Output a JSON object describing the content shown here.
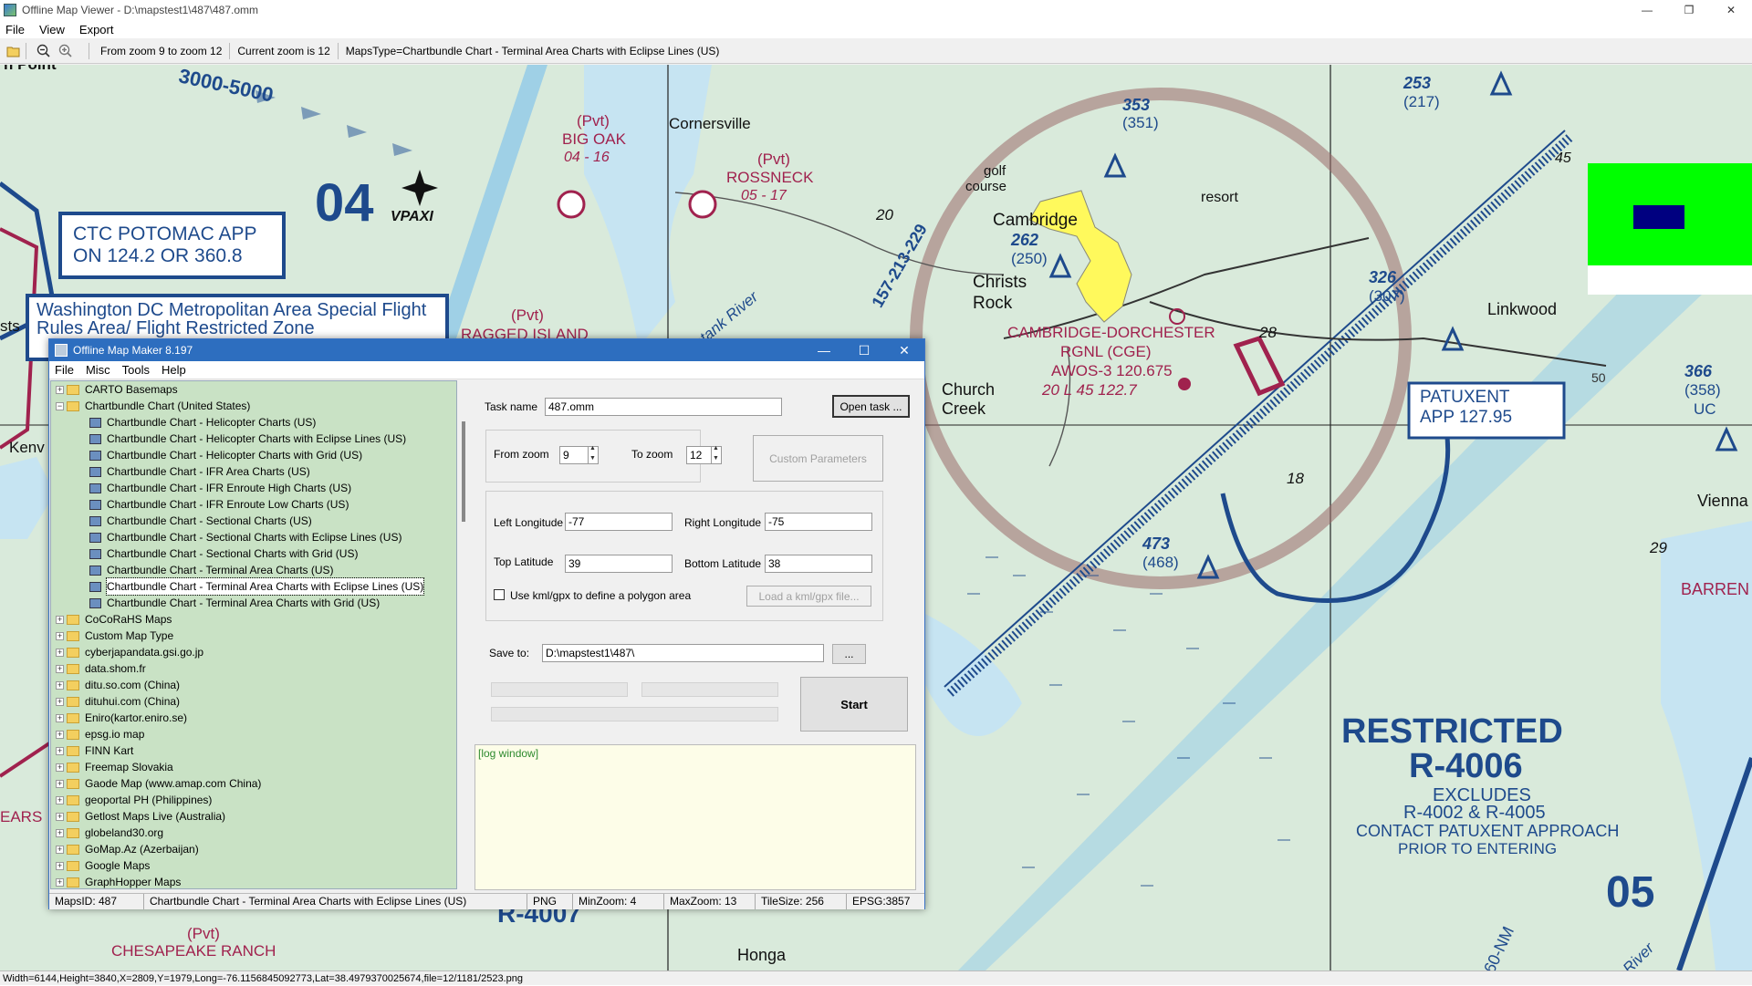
{
  "main_window": {
    "title": "Offline Map Viewer - D:\\mapstest1\\487\\487.omm",
    "controls": {
      "minimize": "—",
      "maximize": "❐",
      "close": "✕"
    },
    "menu": [
      "File",
      "View",
      "Export"
    ],
    "toolbar": {
      "zoom_range": "From zoom 9 to zoom 12",
      "current_zoom": "Current zoom is 12",
      "maps_type": "MapsType=Chartbundle Chart - Terminal Area Charts with Eclipse Lines (US)"
    },
    "status": "Width=6144,Height=3840,X=2809,Y=1979,Long=-76.1156845092773,Lat=38.4979370025674,file=12/1181/2523.png"
  },
  "map_labels": {
    "point": "n Point",
    "kenv": "Kenv",
    "sts": "sts",
    "ears": "EARS",
    "alt_band": "3000-5000",
    "runway": "04",
    "vpaxi": "VPAXI",
    "ctc1": "CTC POTOMAC APP",
    "ctc2": "ON 124.2 OR 360.8",
    "dc1": "Washington DC Metropolitan Area Special Flight",
    "dc2": "Rules Area/ Flight Restricted Zone",
    "pvt1": "(Pvt)",
    "bigoak": "BIG OAK",
    "bigoak_n": "04 - 16",
    "cornersville": "Cornersville",
    "pvt2": "(Pvt)",
    "rossneck": "ROSSNECK",
    "rossneck_n": "05 - 17",
    "pvt3": "(Pvt)",
    "ragged": "RAGGED ISLAND",
    "golf": "golf",
    "course": "course",
    "resort": "resort",
    "cambridge": "Cambridge",
    "alt262": "262",
    "alt250": "(250)",
    "alt353": "353",
    "alt351": "(351)",
    "christs": "Christs",
    "rock": "Rock",
    "choptank": "Choptank River",
    "radial": "157-213-229",
    "cambridge_dorchester": "CAMBRIDGE-DORCHESTER",
    "rgnl": "RGNL (CGE)",
    "awos": "AWOS-3 120.675",
    "freq": "20  L 45 122.7",
    "church": "Church",
    "creek": "Creek",
    "n18": "18",
    "n20": "20",
    "n28": "28",
    "alt326": "326",
    "alt307": "(307)",
    "linkwood": "Linkwood",
    "alt253": "253",
    "alt217": "(217)",
    "n45": "45",
    "patuxent1": "PATUXENT",
    "patuxent2": "APP 127.95",
    "alt366": "366",
    "alt358": "(358)",
    "uc": "UC",
    "vienna": "Vienna",
    "n29": "29",
    "barren": "BARREN",
    "alt473": "473",
    "alt468": "(468)",
    "restricted": "RESTRICTED",
    "r4006": "R-4006",
    "excludes": "EXCLUDES",
    "r4002": "R-4002 & R-4005",
    "contact1": "CONTACT PATUXENT APPROACH",
    "contact2": "PRIOR TO ENTERING",
    "r4007": "R-4007",
    "pvt4": "(Pvt)",
    "chesapeake": "CHESAPEAKE RANCH",
    "honga": "Honga",
    "n05": "05",
    "nm": "60-NM",
    "river": "River",
    "route50": "50"
  },
  "dialog": {
    "title": "Offline Map Maker 8.197",
    "controls": {
      "minimize": "—",
      "maximize": "☐",
      "close": "✕"
    },
    "menu": [
      "File",
      "Misc",
      "Tools",
      "Help"
    ],
    "tree": [
      {
        "label": "CARTO Basemaps",
        "type": "folder",
        "expanded": false
      },
      {
        "label": "Chartbundle Chart (United States)",
        "type": "folder",
        "expanded": true
      },
      {
        "label": "Chartbundle Chart - Helicopter Charts (US)",
        "type": "leaf"
      },
      {
        "label": "Chartbundle Chart - Helicopter Charts with Eclipse Lines (US)",
        "type": "leaf"
      },
      {
        "label": "Chartbundle Chart - Helicopter Charts with Grid (US)",
        "type": "leaf"
      },
      {
        "label": "Chartbundle Chart - IFR Area Charts (US)",
        "type": "leaf"
      },
      {
        "label": "Chartbundle Chart - IFR Enroute High Charts (US)",
        "type": "leaf"
      },
      {
        "label": "Chartbundle Chart - IFR Enroute Low Charts (US)",
        "type": "leaf"
      },
      {
        "label": "Chartbundle Chart - Sectional Charts (US)",
        "type": "leaf"
      },
      {
        "label": "Chartbundle Chart - Sectional Charts with Eclipse Lines (US)",
        "type": "leaf"
      },
      {
        "label": "Chartbundle Chart - Sectional Charts with Grid (US)",
        "type": "leaf"
      },
      {
        "label": "Chartbundle Chart - Terminal Area Charts (US)",
        "type": "leaf"
      },
      {
        "label": "Chartbundle Chart - Terminal Area Charts with Eclipse Lines (US)",
        "type": "leaf",
        "selected": true
      },
      {
        "label": "Chartbundle Chart - Terminal Area Charts with Grid (US)",
        "type": "leaf"
      },
      {
        "label": "CoCoRaHS Maps",
        "type": "folder",
        "expanded": false
      },
      {
        "label": "Custom Map Type",
        "type": "folder",
        "expanded": false
      },
      {
        "label": "cyberjapandata.gsi.go.jp",
        "type": "folder",
        "expanded": false
      },
      {
        "label": "data.shom.fr",
        "type": "folder",
        "expanded": false
      },
      {
        "label": "ditu.so.com (China)",
        "type": "folder",
        "expanded": false
      },
      {
        "label": "dituhui.com (China)",
        "type": "folder",
        "expanded": false
      },
      {
        "label": "Eniro(kartor.eniro.se)",
        "type": "folder",
        "expanded": false
      },
      {
        "label": "epsg.io map",
        "type": "folder",
        "expanded": false
      },
      {
        "label": "FINN Kart",
        "type": "folder",
        "expanded": false
      },
      {
        "label": "Freemap Slovakia",
        "type": "folder",
        "expanded": false
      },
      {
        "label": "Gaode Map (www.amap.com China)",
        "type": "folder",
        "expanded": false
      },
      {
        "label": "geoportal PH (Philippines)",
        "type": "folder",
        "expanded": false
      },
      {
        "label": "Getlost Maps Live (Australia)",
        "type": "folder",
        "expanded": false
      },
      {
        "label": "globeland30.org",
        "type": "folder",
        "expanded": false
      },
      {
        "label": "GoMap.Az (Azerbaijan)",
        "type": "folder",
        "expanded": false
      },
      {
        "label": "Google Maps",
        "type": "folder",
        "expanded": false
      },
      {
        "label": "GraphHopper Maps",
        "type": "folder",
        "expanded": false
      }
    ],
    "task_name_label": "Task name",
    "task_name_value": "487.omm",
    "open_task": "Open task ...",
    "from_zoom_label": "From zoom",
    "from_zoom_value": "9",
    "to_zoom_label": "To zoom",
    "to_zoom_value": "12",
    "custom_params": "Custom Parameters",
    "left_lon_label": "Left Longitude",
    "left_lon_value": "-77",
    "right_lon_label": "Right Longitude",
    "right_lon_value": "-75",
    "top_lat_label": "Top Latitude",
    "top_lat_value": "39",
    "bottom_lat_label": "Bottom Latitude",
    "bottom_lat_value": "38",
    "kml_label": "Use kml/gpx to define a polygon area",
    "load_kml": "Load a kml/gpx file...",
    "save_to_label": "Save to:",
    "save_to_value": "D:\\mapstest1\\487\\",
    "browse": "...",
    "start": "Start",
    "log": "[log window]",
    "status": {
      "maps_id": "MapsID: 487",
      "maps_name": "Chartbundle Chart - Terminal Area Charts with Eclipse Lines (US)",
      "format": "PNG",
      "min_zoom": "MinZoom: 4",
      "max_zoom": "MaxZoom: 13",
      "tile_size": "TileSize: 256",
      "epsg": "EPSG:3857"
    }
  },
  "colors": {
    "map_land": "#d9eadb",
    "water": "#c6e4f2",
    "chart_blue": "#1e4a8c",
    "chart_magenta": "#a0224e",
    "class_d_ring": "#9a6a6a",
    "airport_yellow": "#fff95c",
    "tree_bg": "#c9e2c5",
    "dialog_title": "#2d6ebf",
    "status_green": "#00ff00"
  },
  "icons": [
    "app-icon",
    "open-folder-icon",
    "zoom-out-icon",
    "zoom-in-icon",
    "expand-icon",
    "folder-icon",
    "map-layer-icon"
  ]
}
